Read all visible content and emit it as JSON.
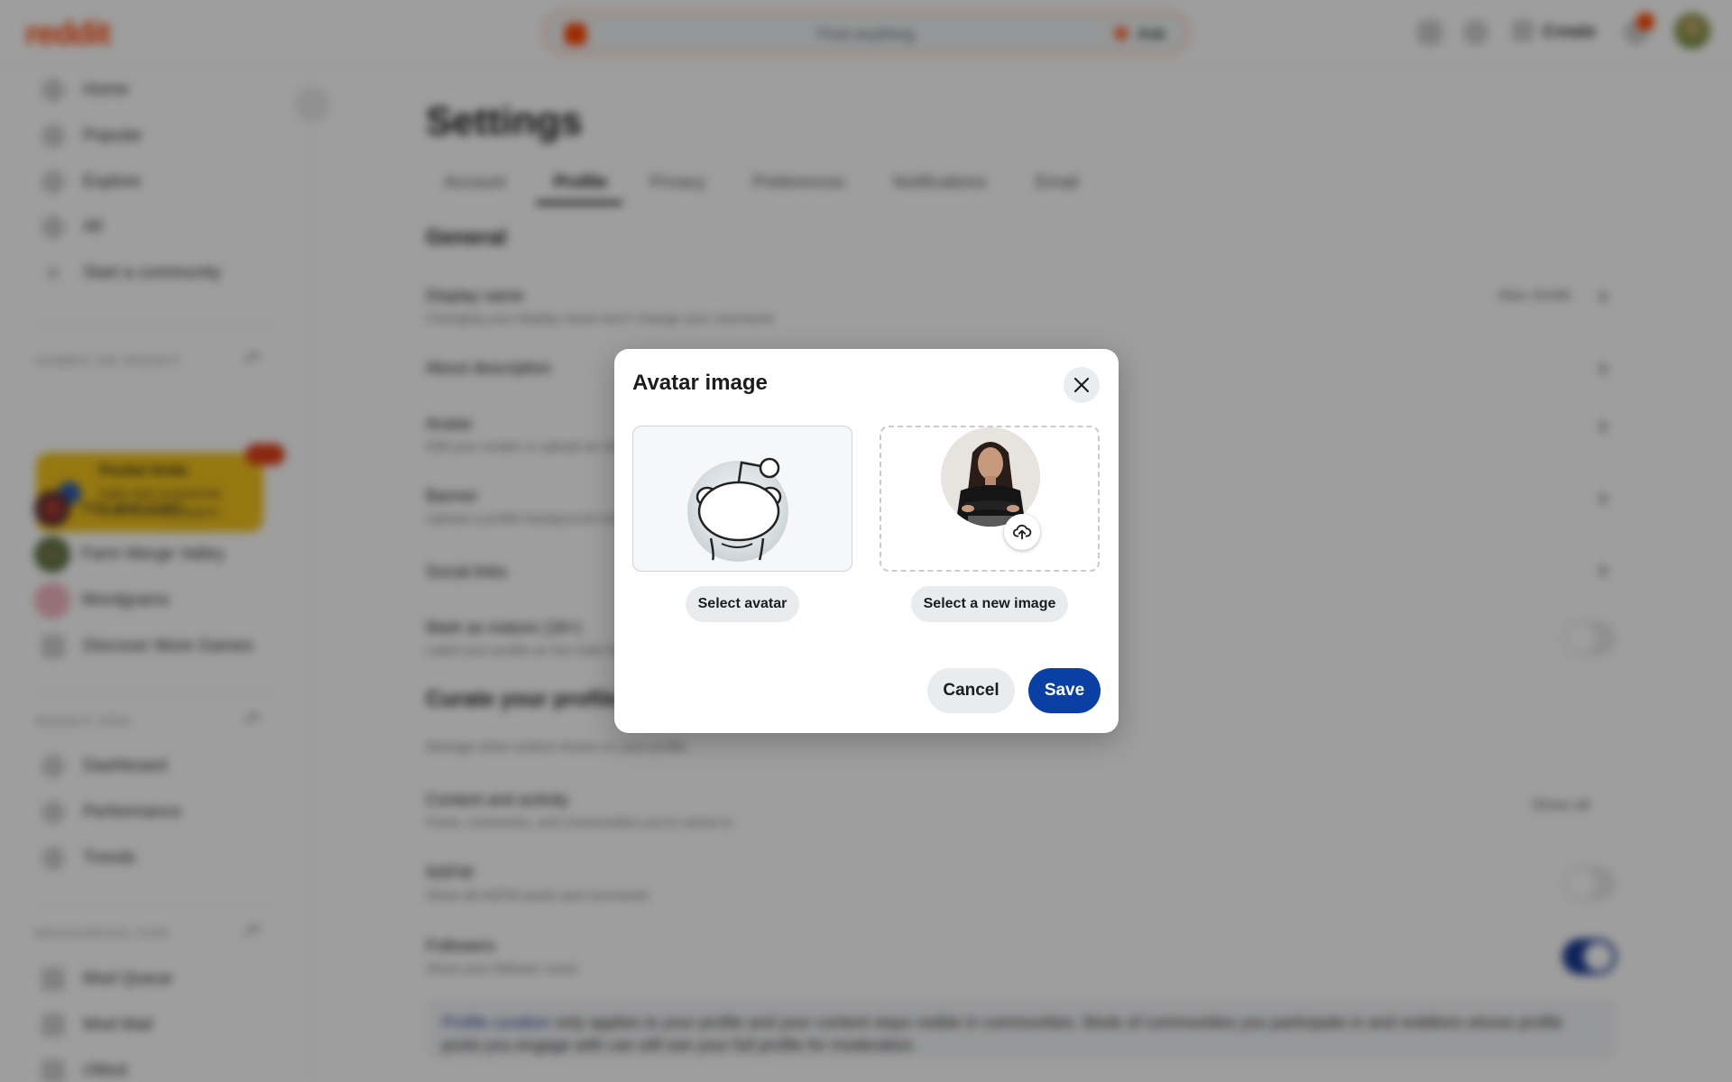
{
  "topbar": {
    "logo": "reddit",
    "search_placeholder": "Find anything",
    "ask_label": "Ask",
    "create_label": "Create"
  },
  "sidebar": {
    "nav": [
      {
        "label": "Home",
        "icon": "home-icon"
      },
      {
        "label": "Popular",
        "icon": "popular-icon"
      },
      {
        "label": "Explore",
        "icon": "explore-icon"
      },
      {
        "label": "All",
        "icon": "all-icon"
      },
      {
        "label": "Start a community",
        "icon": "plus-icon"
      }
    ],
    "games_header": "GAMES ON REDDIT",
    "promo": {
      "title": "Pocket Grids",
      "subtitle": "Daily mini crosswords",
      "link": "3.6M monthly players"
    },
    "communities": [
      {
        "label": "Hot and Cold"
      },
      {
        "label": "Farm Merge Valley"
      },
      {
        "label": "Wordgrams"
      },
      {
        "label": "Discover More Games"
      }
    ],
    "reddit_pro_header": "REDDIT PRO",
    "pro_items": [
      {
        "label": "Dashboard"
      },
      {
        "label": "Performance"
      },
      {
        "label": "Trends"
      }
    ],
    "resources_header": "RESOURCES FOR",
    "resource_items": [
      {
        "label": "Mod Queue"
      },
      {
        "label": "Mod Mail"
      },
      {
        "label": "r/Mod"
      }
    ]
  },
  "settings": {
    "title": "Settings",
    "tabs": [
      "Account",
      "Profile",
      "Privacy",
      "Preferences",
      "Notifications",
      "Email"
    ],
    "active_tab": "Profile",
    "general_title": "General",
    "rows": [
      {
        "label": "Display name",
        "sub": "Changing your display name won't change your username",
        "value": "Alex Smith"
      },
      {
        "label": "About description",
        "sub": ""
      },
      {
        "label": "Avatar",
        "sub": "Edit your avatar or upload an image"
      },
      {
        "label": "Banner",
        "sub": "Upload a profile background image"
      },
      {
        "label": "Social links",
        "sub": ""
      },
      {
        "label": "Mark as mature (18+)",
        "sub": "Label your profile as Not Safe for Work"
      }
    ],
    "curate_title": "Curate your profile",
    "curate_sub": "Manage what content shows on your profile",
    "curate_rows": [
      {
        "label": "Content and activity",
        "sub": "Posts, comments, and communities you're active in",
        "value": "Show all"
      },
      {
        "label": "NSFW",
        "sub": "Show all NSFW posts and comments"
      },
      {
        "label": "Followers",
        "sub": "Show your follower count"
      }
    ],
    "footnote_link": "Profile curation",
    "footnote_text": " only applies to your profile and your content stays visible in communities. Mods of communities you participate in and redditors whose profile posts you engage with can still see your full profile for moderation."
  },
  "modal": {
    "title": "Avatar image",
    "select_avatar_label": "Select avatar",
    "select_new_image_label": "Select a new image",
    "cancel_label": "Cancel",
    "save_label": "Save"
  },
  "colors": {
    "brand": "#ff4500",
    "save_button": "#0a3fa3",
    "toggle_on": "#1b3c93"
  }
}
